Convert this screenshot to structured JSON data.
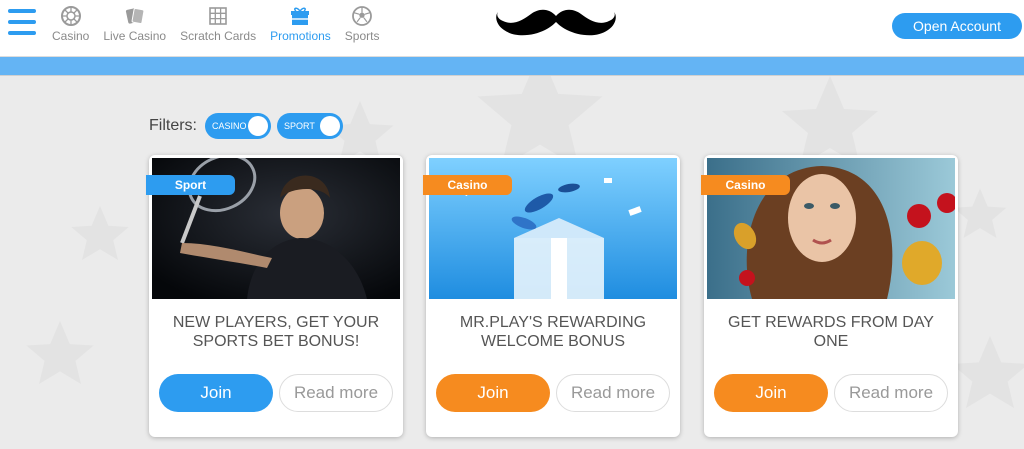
{
  "header": {
    "nav": [
      {
        "label": "Casino",
        "icon": "roulette-icon"
      },
      {
        "label": "Live Casino",
        "icon": "cards-icon"
      },
      {
        "label": "Scratch Cards",
        "icon": "scratch-card-icon"
      },
      {
        "label": "Promotions",
        "icon": "gift-icon",
        "active": true
      },
      {
        "label": "Sports",
        "icon": "soccer-ball-icon"
      }
    ],
    "logo": "mustache-logo",
    "open_account_label": "Open Account"
  },
  "filters": {
    "label": "Filters:",
    "toggles": [
      {
        "label": "CASINO",
        "on": true
      },
      {
        "label": "SPORT",
        "on": true
      }
    ]
  },
  "cards": [
    {
      "badge": "Sport",
      "title": "NEW PLAYERS, GET YOUR SPORTS BET BONUS!",
      "join_label": "Join",
      "more_label": "Read more",
      "image": "tennis-player-image"
    },
    {
      "badge": "Casino",
      "title": "MR.PLAY'S REWARDING WELCOME BONUS",
      "join_label": "Join",
      "more_label": "Read more",
      "image": "gift-box-chips-image"
    },
    {
      "badge": "Casino",
      "title": "GET REWARDS FROM DAY ONE",
      "join_label": "Join",
      "more_label": "Read more",
      "image": "woman-cherries-coins-image"
    }
  ],
  "colors": {
    "accent_blue": "#2d9cf0",
    "accent_orange": "#f68b1f",
    "band_blue": "#64b4f4"
  }
}
